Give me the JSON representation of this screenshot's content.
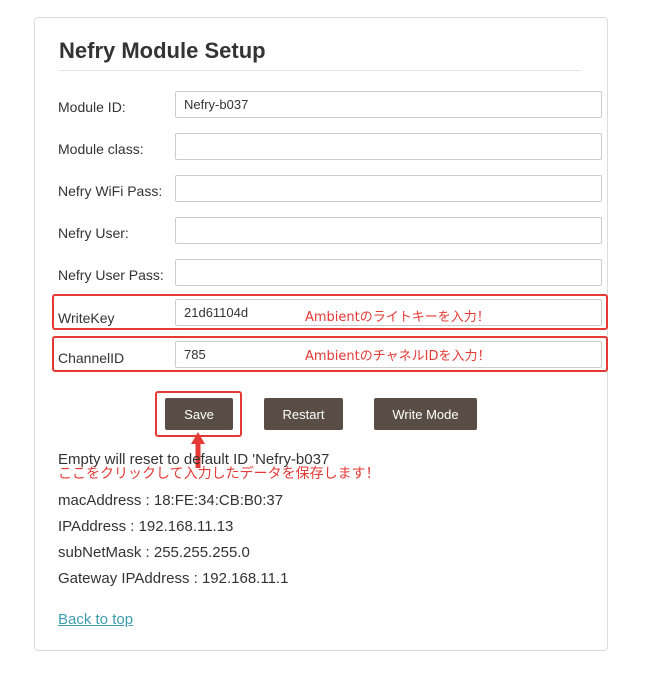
{
  "page": {
    "title": "Nefry Module Setup"
  },
  "form": {
    "fields": [
      {
        "label": "Module ID:",
        "value": "Nefry-b037"
      },
      {
        "label": "Module class:",
        "value": ""
      },
      {
        "label": "Nefry WiFi Pass:",
        "value": ""
      },
      {
        "label": "Nefry User:",
        "value": ""
      },
      {
        "label": "Nefry User Pass:",
        "value": ""
      },
      {
        "label": "WriteKey",
        "value": "21d61104d"
      },
      {
        "label": "ChannelID",
        "value": "785"
      }
    ]
  },
  "annotations": {
    "writekey_note": "Ambientのライトキーを入力！",
    "channelid_note": "AmbientのチャネルIDを入力！",
    "save_note": "ここをクリックして入力したデータを保存します！",
    "color": "#e53935"
  },
  "buttons": {
    "save": "Save",
    "restart": "Restart",
    "write_mode": "Write Mode"
  },
  "info": {
    "reset_note": "Empty will reset to default ID 'Nefry-b037",
    "mac": "macAddress : 18:FE:34:CB:B0:37",
    "ip": "IPAddress : 192.168.11.13",
    "subnet": "subNetMask : 255.255.255.0",
    "gateway": "Gateway IPAddress : 192.168.11.1"
  },
  "links": {
    "back": "Back to top"
  },
  "colors": {
    "button_bg": "#5a4d46",
    "link": "#3d9db3",
    "highlight": "#e53935"
  }
}
